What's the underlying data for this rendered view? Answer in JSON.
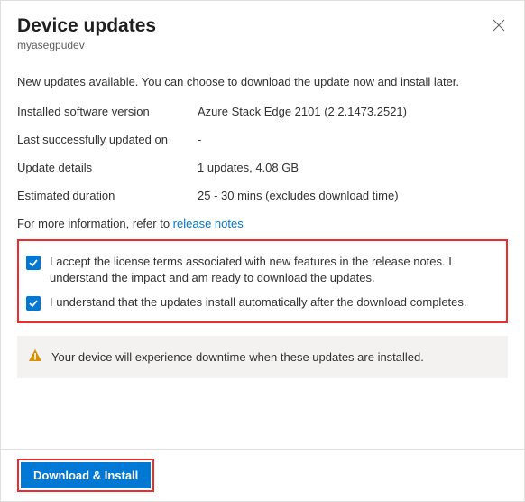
{
  "header": {
    "title": "Device updates",
    "subtitle": "myasegpudev"
  },
  "intro": "New updates available. You can choose to download the update now and install later.",
  "fields": {
    "installed_version_label": "Installed software version",
    "installed_version_value": "Azure Stack Edge 2101 (2.2.1473.2521)",
    "last_updated_label": "Last successfully updated on",
    "last_updated_value": "-",
    "update_details_label": "Update details",
    "update_details_value": "1 updates, 4.08 GB",
    "estimated_duration_label": "Estimated duration",
    "estimated_duration_value": "25 - 30 mins (excludes download time)"
  },
  "more_info_prefix": "For more information, refer to ",
  "more_info_link": "release notes",
  "checkboxes": {
    "accept_license": "I accept the license terms associated with new features in the release notes. I understand the impact and am ready to download the updates.",
    "auto_install": "I understand that the updates install automatically after the download completes."
  },
  "warning": "Your device will experience downtime when these updates are installed.",
  "action_button": "Download & Install"
}
